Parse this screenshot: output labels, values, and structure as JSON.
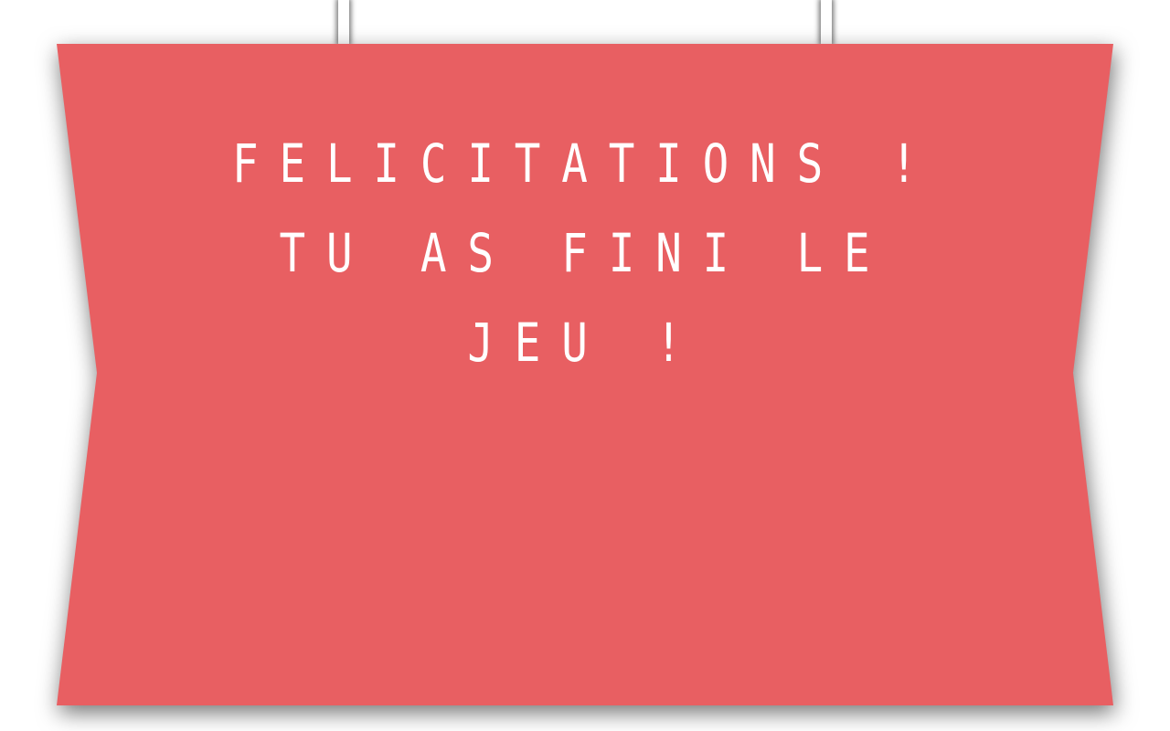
{
  "end_screen": {
    "message_lines": [
      "FELICITATIONS !",
      "TU AS FINI LE",
      "JEU !"
    ],
    "banner_color": "#e85f62",
    "text_color": "#ffffff",
    "background_color": "#ffffff"
  }
}
